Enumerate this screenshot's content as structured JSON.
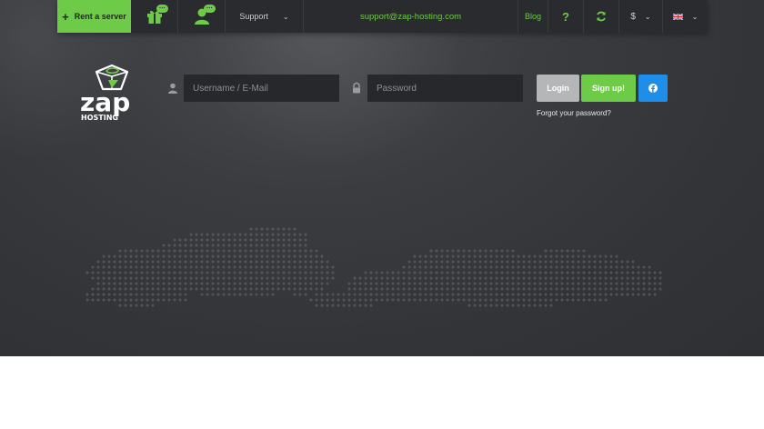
{
  "topbar": {
    "rent_label": "Rent a server",
    "gift_badge": "···",
    "user_badge": "···",
    "support_label": "Support",
    "email": "support@zap-hosting.com",
    "blog_label": "Blog",
    "help_label": "?",
    "currency": "$"
  },
  "logo": {
    "text_main": "zap",
    "text_sub": "HOSTING"
  },
  "login": {
    "username_placeholder": "Username / E-Mail",
    "password_placeholder": "Password",
    "login_label": "Login",
    "signup_label": "Sign up!",
    "forgot_label": "Forgot your password?"
  },
  "colors": {
    "brand_green": "#6ecb47",
    "facebook_blue": "#1f8ee8",
    "topbar_bg": "#2a2b2e",
    "hero_bg": "#35373b"
  }
}
